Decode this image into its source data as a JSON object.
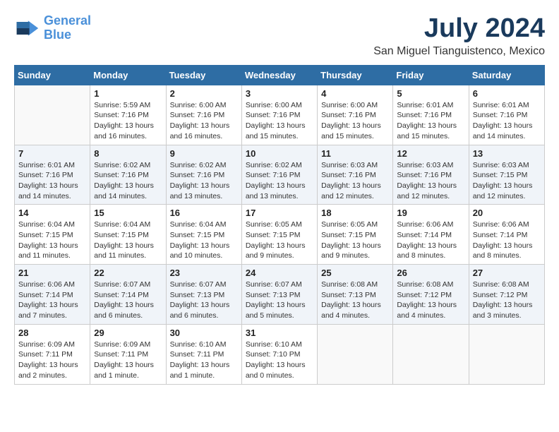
{
  "header": {
    "logo_line1": "General",
    "logo_line2": "Blue",
    "month_title": "July 2024",
    "location": "San Miguel Tianguistenco, Mexico"
  },
  "weekdays": [
    "Sunday",
    "Monday",
    "Tuesday",
    "Wednesday",
    "Thursday",
    "Friday",
    "Saturday"
  ],
  "weeks": [
    [
      {
        "day": "",
        "sunrise": "",
        "sunset": "",
        "daylight": ""
      },
      {
        "day": "1",
        "sunrise": "Sunrise: 5:59 AM",
        "sunset": "Sunset: 7:16 PM",
        "daylight": "Daylight: 13 hours and 16 minutes."
      },
      {
        "day": "2",
        "sunrise": "Sunrise: 6:00 AM",
        "sunset": "Sunset: 7:16 PM",
        "daylight": "Daylight: 13 hours and 16 minutes."
      },
      {
        "day": "3",
        "sunrise": "Sunrise: 6:00 AM",
        "sunset": "Sunset: 7:16 PM",
        "daylight": "Daylight: 13 hours and 15 minutes."
      },
      {
        "day": "4",
        "sunrise": "Sunrise: 6:00 AM",
        "sunset": "Sunset: 7:16 PM",
        "daylight": "Daylight: 13 hours and 15 minutes."
      },
      {
        "day": "5",
        "sunrise": "Sunrise: 6:01 AM",
        "sunset": "Sunset: 7:16 PM",
        "daylight": "Daylight: 13 hours and 15 minutes."
      },
      {
        "day": "6",
        "sunrise": "Sunrise: 6:01 AM",
        "sunset": "Sunset: 7:16 PM",
        "daylight": "Daylight: 13 hours and 14 minutes."
      }
    ],
    [
      {
        "day": "7",
        "sunrise": "Sunrise: 6:01 AM",
        "sunset": "Sunset: 7:16 PM",
        "daylight": "Daylight: 13 hours and 14 minutes."
      },
      {
        "day": "8",
        "sunrise": "Sunrise: 6:02 AM",
        "sunset": "Sunset: 7:16 PM",
        "daylight": "Daylight: 13 hours and 14 minutes."
      },
      {
        "day": "9",
        "sunrise": "Sunrise: 6:02 AM",
        "sunset": "Sunset: 7:16 PM",
        "daylight": "Daylight: 13 hours and 13 minutes."
      },
      {
        "day": "10",
        "sunrise": "Sunrise: 6:02 AM",
        "sunset": "Sunset: 7:16 PM",
        "daylight": "Daylight: 13 hours and 13 minutes."
      },
      {
        "day": "11",
        "sunrise": "Sunrise: 6:03 AM",
        "sunset": "Sunset: 7:16 PM",
        "daylight": "Daylight: 13 hours and 12 minutes."
      },
      {
        "day": "12",
        "sunrise": "Sunrise: 6:03 AM",
        "sunset": "Sunset: 7:16 PM",
        "daylight": "Daylight: 13 hours and 12 minutes."
      },
      {
        "day": "13",
        "sunrise": "Sunrise: 6:03 AM",
        "sunset": "Sunset: 7:15 PM",
        "daylight": "Daylight: 13 hours and 12 minutes."
      }
    ],
    [
      {
        "day": "14",
        "sunrise": "Sunrise: 6:04 AM",
        "sunset": "Sunset: 7:15 PM",
        "daylight": "Daylight: 13 hours and 11 minutes."
      },
      {
        "day": "15",
        "sunrise": "Sunrise: 6:04 AM",
        "sunset": "Sunset: 7:15 PM",
        "daylight": "Daylight: 13 hours and 11 minutes."
      },
      {
        "day": "16",
        "sunrise": "Sunrise: 6:04 AM",
        "sunset": "Sunset: 7:15 PM",
        "daylight": "Daylight: 13 hours and 10 minutes."
      },
      {
        "day": "17",
        "sunrise": "Sunrise: 6:05 AM",
        "sunset": "Sunset: 7:15 PM",
        "daylight": "Daylight: 13 hours and 9 minutes."
      },
      {
        "day": "18",
        "sunrise": "Sunrise: 6:05 AM",
        "sunset": "Sunset: 7:15 PM",
        "daylight": "Daylight: 13 hours and 9 minutes."
      },
      {
        "day": "19",
        "sunrise": "Sunrise: 6:06 AM",
        "sunset": "Sunset: 7:14 PM",
        "daylight": "Daylight: 13 hours and 8 minutes."
      },
      {
        "day": "20",
        "sunrise": "Sunrise: 6:06 AM",
        "sunset": "Sunset: 7:14 PM",
        "daylight": "Daylight: 13 hours and 8 minutes."
      }
    ],
    [
      {
        "day": "21",
        "sunrise": "Sunrise: 6:06 AM",
        "sunset": "Sunset: 7:14 PM",
        "daylight": "Daylight: 13 hours and 7 minutes."
      },
      {
        "day": "22",
        "sunrise": "Sunrise: 6:07 AM",
        "sunset": "Sunset: 7:14 PM",
        "daylight": "Daylight: 13 hours and 6 minutes."
      },
      {
        "day": "23",
        "sunrise": "Sunrise: 6:07 AM",
        "sunset": "Sunset: 7:13 PM",
        "daylight": "Daylight: 13 hours and 6 minutes."
      },
      {
        "day": "24",
        "sunrise": "Sunrise: 6:07 AM",
        "sunset": "Sunset: 7:13 PM",
        "daylight": "Daylight: 13 hours and 5 minutes."
      },
      {
        "day": "25",
        "sunrise": "Sunrise: 6:08 AM",
        "sunset": "Sunset: 7:13 PM",
        "daylight": "Daylight: 13 hours and 4 minutes."
      },
      {
        "day": "26",
        "sunrise": "Sunrise: 6:08 AM",
        "sunset": "Sunset: 7:12 PM",
        "daylight": "Daylight: 13 hours and 4 minutes."
      },
      {
        "day": "27",
        "sunrise": "Sunrise: 6:08 AM",
        "sunset": "Sunset: 7:12 PM",
        "daylight": "Daylight: 13 hours and 3 minutes."
      }
    ],
    [
      {
        "day": "28",
        "sunrise": "Sunrise: 6:09 AM",
        "sunset": "Sunset: 7:11 PM",
        "daylight": "Daylight: 13 hours and 2 minutes."
      },
      {
        "day": "29",
        "sunrise": "Sunrise: 6:09 AM",
        "sunset": "Sunset: 7:11 PM",
        "daylight": "Daylight: 13 hours and 1 minute."
      },
      {
        "day": "30",
        "sunrise": "Sunrise: 6:10 AM",
        "sunset": "Sunset: 7:11 PM",
        "daylight": "Daylight: 13 hours and 1 minute."
      },
      {
        "day": "31",
        "sunrise": "Sunrise: 6:10 AM",
        "sunset": "Sunset: 7:10 PM",
        "daylight": "Daylight: 13 hours and 0 minutes."
      },
      {
        "day": "",
        "sunrise": "",
        "sunset": "",
        "daylight": ""
      },
      {
        "day": "",
        "sunrise": "",
        "sunset": "",
        "daylight": ""
      },
      {
        "day": "",
        "sunrise": "",
        "sunset": "",
        "daylight": ""
      }
    ]
  ]
}
